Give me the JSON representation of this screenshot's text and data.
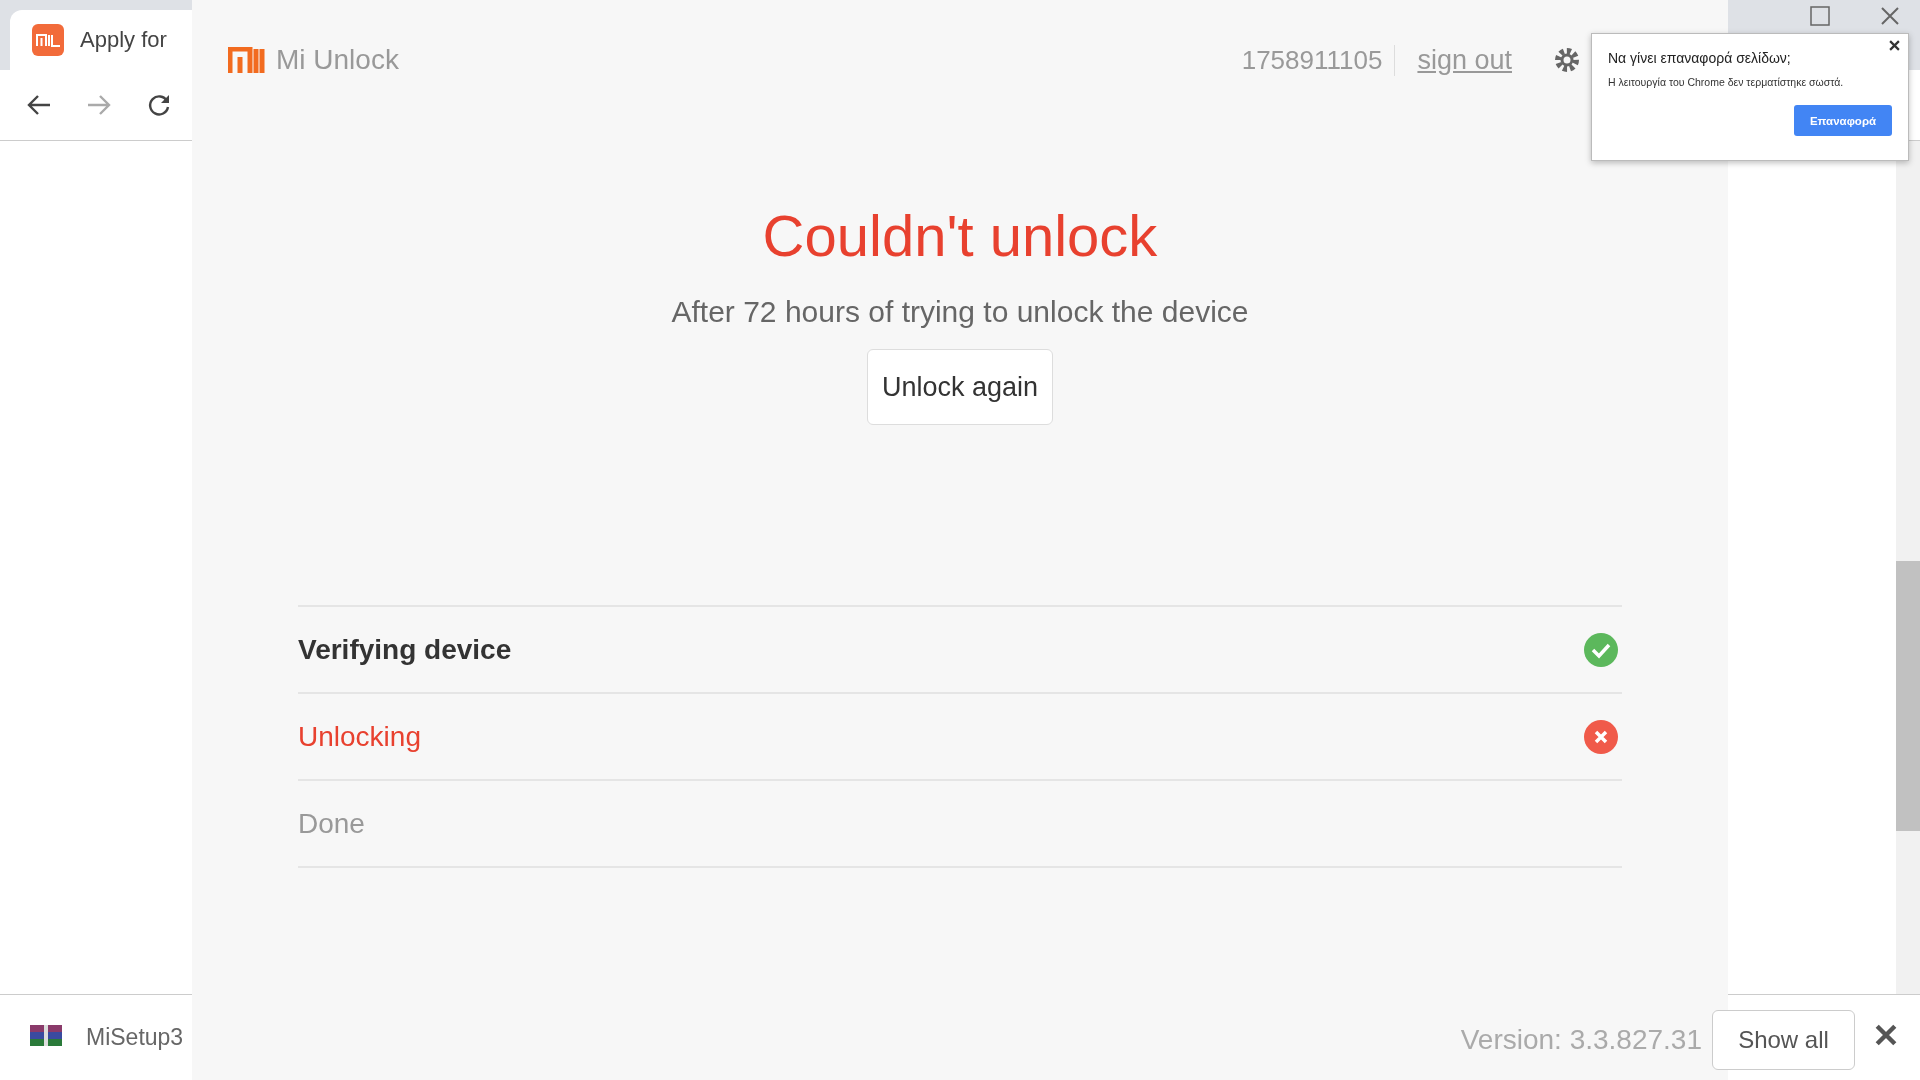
{
  "browser": {
    "tab_title": "Apply for",
    "download": {
      "file": "MiSetup3"
    },
    "show_all": "Show all"
  },
  "app": {
    "title": "Mi Unlock",
    "account": "1758911105",
    "sign_out": "sign out",
    "heading": "Couldn't unlock",
    "message": "After 72 hours of trying to unlock the device",
    "button": "Unlock again",
    "steps": [
      {
        "label": "Verifying device",
        "kind": "done"
      },
      {
        "label": "Unlocking",
        "kind": "failed"
      },
      {
        "label": "Done",
        "kind": "pending"
      }
    ],
    "version": "Version: 3.3.827.31"
  },
  "restore_popup": {
    "title": "Να γίνει επαναφορά σελίδων;",
    "message": "Η λειτουργία του Chrome δεν τερματίστηκε σωστά.",
    "button": "Επαναφορά"
  }
}
